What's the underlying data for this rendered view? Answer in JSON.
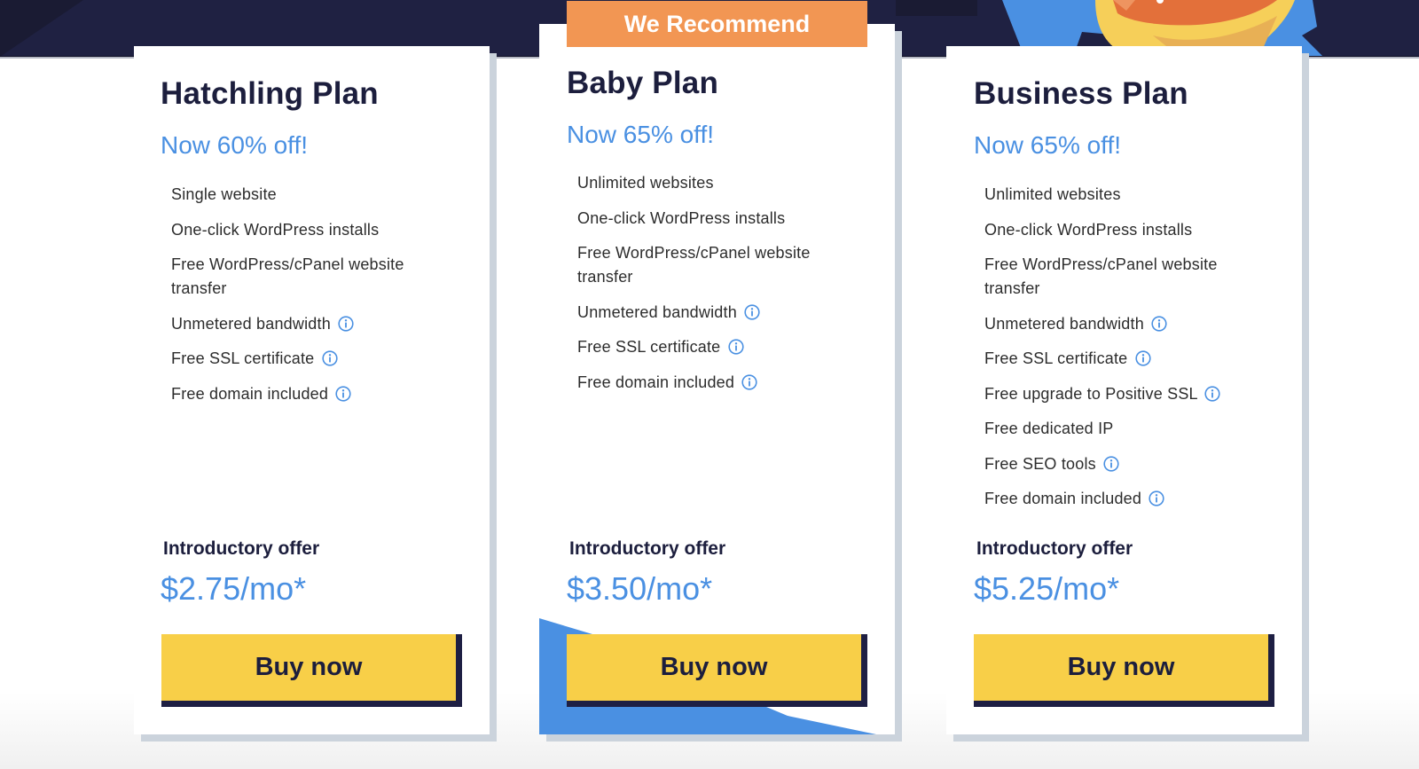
{
  "colors": {
    "navy": "#1f2142",
    "accent_blue": "#4a90e2",
    "ribbon_orange": "#f29653",
    "button_yellow": "#f8cf48",
    "card_shadow": "#cbd3dc"
  },
  "plans": [
    {
      "name": "Hatchling Plan",
      "discount": "Now 60% off!",
      "recommended": false,
      "features": [
        {
          "text": "Single website",
          "info_icon": false
        },
        {
          "text": "One-click WordPress installs",
          "info_icon": false
        },
        {
          "text": "Free WordPress/cPanel website transfer",
          "info_icon": false
        },
        {
          "text": "Unmetered bandwidth",
          "info_icon": true
        },
        {
          "text": "Free SSL certificate",
          "info_icon": true
        },
        {
          "text": "Free domain included",
          "info_icon": true
        }
      ],
      "offer_label": "Introductory offer",
      "price": "$2.75/mo*",
      "button_label": "Buy now"
    },
    {
      "name": "Baby Plan",
      "discount": "Now 65% off!",
      "recommended": true,
      "ribbon_label": "We Recommend",
      "features": [
        {
          "text": "Unlimited websites",
          "info_icon": false
        },
        {
          "text": "One-click WordPress installs",
          "info_icon": false
        },
        {
          "text": "Free WordPress/cPanel website transfer",
          "info_icon": false
        },
        {
          "text": "Unmetered bandwidth",
          "info_icon": true
        },
        {
          "text": "Free SSL certificate",
          "info_icon": true
        },
        {
          "text": "Free domain included",
          "info_icon": true
        }
      ],
      "offer_label": "Introductory offer",
      "price": "$3.50/mo*",
      "button_label": "Buy now"
    },
    {
      "name": "Business Plan",
      "discount": "Now 65% off!",
      "recommended": false,
      "features": [
        {
          "text": "Unlimited websites",
          "info_icon": false
        },
        {
          "text": "One-click WordPress installs",
          "info_icon": false
        },
        {
          "text": "Free WordPress/cPanel website transfer",
          "info_icon": false
        },
        {
          "text": "Unmetered bandwidth",
          "info_icon": true
        },
        {
          "text": "Free SSL certificate",
          "info_icon": true
        },
        {
          "text": "Free upgrade to Positive SSL",
          "info_icon": true
        },
        {
          "text": "Free dedicated IP",
          "info_icon": false
        },
        {
          "text": "Free SEO tools",
          "info_icon": true
        },
        {
          "text": "Free domain included",
          "info_icon": true
        }
      ],
      "offer_label": "Introductory offer",
      "price": "$5.25/mo*",
      "button_label": "Buy now"
    }
  ],
  "icons": {
    "info": "info-circle-icon"
  }
}
